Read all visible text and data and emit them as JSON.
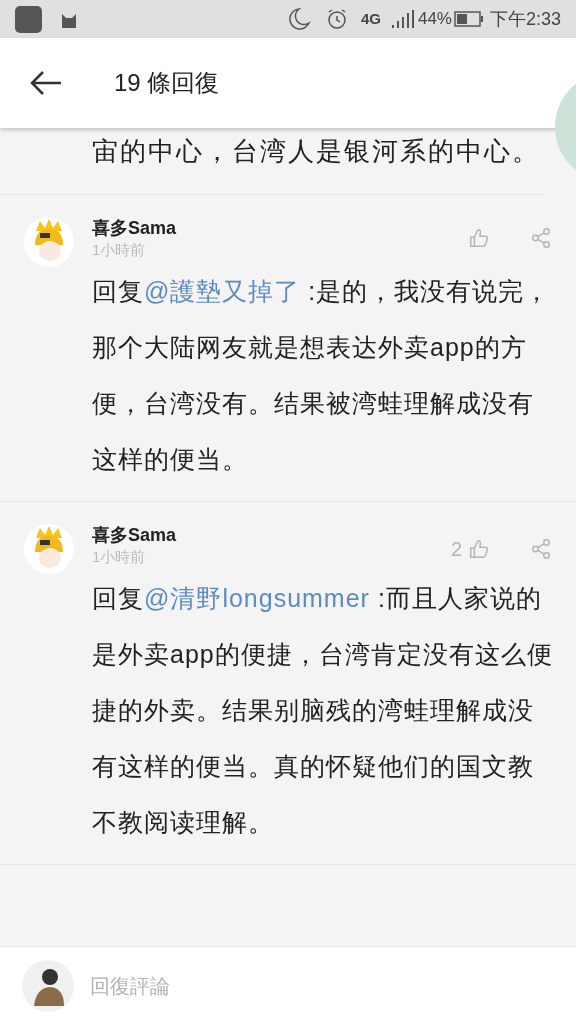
{
  "status_bar": {
    "network": "4G",
    "battery": "44%",
    "time": "下午2:33"
  },
  "header": {
    "title": "19 條回復"
  },
  "partial_comment": {
    "text": "宙的中心，台湾人是银河系的中心。"
  },
  "comments": [
    {
      "author": "喜多Sama",
      "time": "1小時前",
      "prefix": "回复",
      "mention": "@護墊又掉了",
      "text": " :是的，我没有说完，那个大陆网友就是想表达外卖app的方便，台湾没有。结果被湾蛙理解成没有这样的便当。"
    },
    {
      "author": "喜多Sama",
      "time": "1小時前",
      "likes": "2",
      "prefix": "回复",
      "mention": "@清野longsummer",
      "text": " :而且人家说的是外卖app的便捷，台湾肯定没有这么便捷的外卖。结果别脑残的湾蛙理解成没有这样的便当。真的怀疑他们的国文教不教阅读理解。"
    }
  ],
  "reply_bar": {
    "placeholder": "回復評論"
  }
}
